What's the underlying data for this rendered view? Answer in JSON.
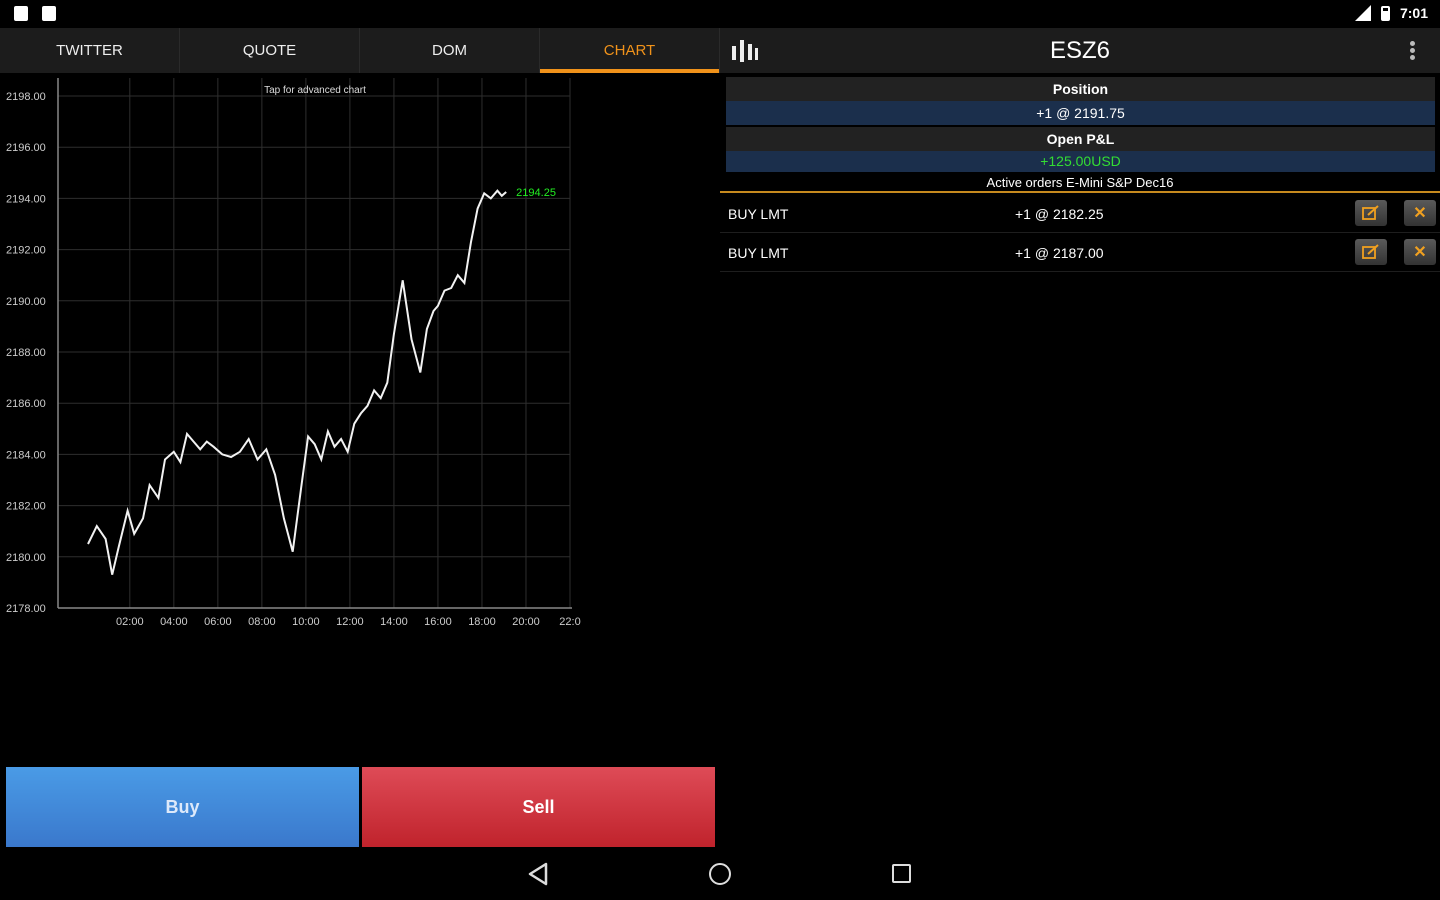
{
  "status_bar": {
    "time": "7:01"
  },
  "tabs": [
    {
      "label": "TWITTER"
    },
    {
      "label": "QUOTE"
    },
    {
      "label": "DOM"
    },
    {
      "label": "CHART",
      "active": true
    }
  ],
  "header": {
    "symbol": "ESZ6"
  },
  "position": {
    "label": "Position",
    "value": "+1 @ 2191.75"
  },
  "pnl": {
    "label": "Open P&L",
    "value": "+125.00USD",
    "color": "#33dd33"
  },
  "orders": {
    "title": "Active orders E-Mini S&P Dec16",
    "rows": [
      {
        "type": "BUY LMT",
        "qty": "+1 @ 2182.25"
      },
      {
        "type": "BUY LMT",
        "qty": "+1 @ 2187.00"
      }
    ]
  },
  "buttons": {
    "buy": "Buy",
    "sell": "Sell"
  },
  "colors": {
    "accent": "#f0921a",
    "buy": "#4a9be6",
    "sell": "#c0232c",
    "last_price": "#22ee22"
  },
  "chart_data": {
    "type": "line",
    "title": "Tap for advanced chart",
    "y_ticks": [
      "2198.00",
      "2196.00",
      "2194.00",
      "2192.00",
      "2190.00",
      "2188.00",
      "2186.00",
      "2184.00",
      "2182.00",
      "2180.00",
      "2178.00"
    ],
    "x_ticks": [
      "02:00",
      "04:00",
      "06:00",
      "08:00",
      "10:00",
      "12:00",
      "14:00",
      "16:00",
      "18:00",
      "20:00",
      "22:0"
    ],
    "ylim": [
      2178,
      2198
    ],
    "xlim": [
      0.1,
      22.0
    ],
    "grid": true,
    "last_price_label": "2194.25",
    "series": [
      {
        "x": [
          0.1,
          0.5,
          0.9,
          1.2,
          1.5,
          1.9,
          2.2,
          2.6,
          2.9,
          3.3,
          3.6,
          4.0,
          4.3,
          4.6,
          4.9,
          5.2,
          5.5,
          5.8,
          6.2,
          6.6,
          7.0,
          7.4,
          7.8,
          8.2,
          8.6,
          9.0,
          9.4,
          9.8,
          10.1,
          10.4,
          10.7,
          11.0,
          11.3,
          11.6,
          11.9,
          12.2,
          12.5,
          12.8,
          13.1,
          13.4,
          13.7,
          14.0,
          14.4,
          14.8,
          15.2,
          15.5,
          15.8,
          16.0,
          16.3,
          16.6,
          16.9,
          17.2,
          17.5,
          17.8,
          18.1,
          18.4,
          18.7,
          18.9,
          19.1
        ],
        "y": [
          2180.5,
          2181.2,
          2180.7,
          2179.3,
          2180.4,
          2181.8,
          2180.9,
          2181.5,
          2182.8,
          2182.3,
          2183.8,
          2184.1,
          2183.7,
          2184.8,
          2184.5,
          2184.2,
          2184.5,
          2184.3,
          2184.0,
          2183.9,
          2184.1,
          2184.6,
          2183.8,
          2184.2,
          2183.2,
          2181.5,
          2180.2,
          2182.8,
          2184.7,
          2184.4,
          2183.8,
          2184.9,
          2184.3,
          2184.6,
          2184.1,
          2185.2,
          2185.6,
          2185.9,
          2186.5,
          2186.2,
          2186.8,
          2188.7,
          2190.8,
          2188.5,
          2187.2,
          2188.9,
          2189.6,
          2189.8,
          2190.4,
          2190.5,
          2191.0,
          2190.7,
          2192.3,
          2193.6,
          2194.2,
          2194.0,
          2194.3,
          2194.1,
          2194.25
        ]
      }
    ]
  }
}
